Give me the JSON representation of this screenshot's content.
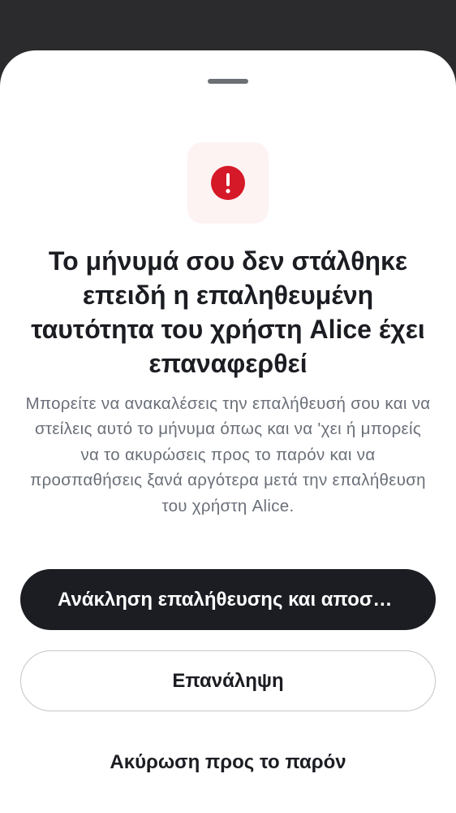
{
  "dialog": {
    "icon": "exclamation-circle-icon",
    "title": "Το μήνυμά σου δεν στάλθηκε επειδή η επαληθευμένη ταυτότητα του χρήστη Alice έχει επαναφερθεί",
    "body": "Μπορείτε να ανακαλέσεις την επαλήθευσή σου και να στείλεις αυτό το μήνυμα όπως και να 'χει ή μπορείς να το ακυρώσεις προς το παρόν και να προσπαθήσεις ξανά αργότερα μετά την επαλήθευση του χρήστη Alice."
  },
  "actions": {
    "primary_label": "Ανάκληση επαλήθευσης και αποστολή",
    "secondary_label": "Επανάληψη",
    "tertiary_label": "Ακύρωση προς το παρόν"
  },
  "colors": {
    "backdrop": "#2b2b2d",
    "sheet": "#ffffff",
    "alert": "#d51928",
    "alert_tile": "#fdf3f3",
    "primary_button": "#1b1d22"
  }
}
